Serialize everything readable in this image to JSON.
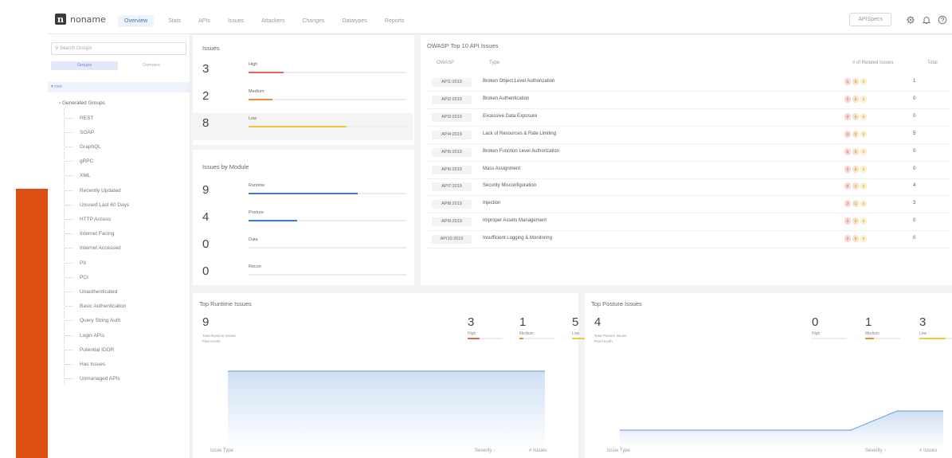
{
  "nav": {
    "logo_letter": "n",
    "logo_text": "noname",
    "items": [
      "Overview",
      "Stats",
      "APIs",
      "Issues",
      "Attackers",
      "Changes",
      "Datatypes",
      "Reports"
    ],
    "apispecs": "APISpecs"
  },
  "sidebar": {
    "search_placeholder": "Search Groups",
    "tabs": [
      "Groups",
      "Domains"
    ],
    "root": "▾ root",
    "generated": "› Generated Groups",
    "items": [
      "REST",
      "SOAP",
      "GraphQL",
      "gRPC",
      "XML",
      "Recently Updated",
      "Unused Last 60 Days",
      "HTTP Access",
      "Internet Facing",
      "Internet Accessed",
      "PII",
      "PCI",
      "Unauthenticated",
      "Basic Authentication",
      "Query String Auth",
      "Login APIs",
      "Potential IDOR",
      "Has Issues",
      "Unmanaged APIs"
    ]
  },
  "issues": {
    "title": "Issues",
    "rows": [
      {
        "num": "3",
        "label": "High",
        "frac": 0.22,
        "color": "#e0685a"
      },
      {
        "num": "2",
        "label": "Medium",
        "frac": 0.15,
        "color": "#ef8c2b"
      },
      {
        "num": "8",
        "label": "Low",
        "frac": 0.62,
        "color": "#f1c645"
      }
    ]
  },
  "modules": {
    "title": "Issues by Module",
    "rows": [
      {
        "num": "9",
        "label": "Runtime",
        "frac": 0.69,
        "color": "#3b7dcc"
      },
      {
        "num": "4",
        "label": "Posture",
        "frac": 0.31,
        "color": "#3b7dcc"
      },
      {
        "num": "0",
        "label": "Data",
        "frac": 0,
        "color": "#3b7dcc"
      },
      {
        "num": "0",
        "label": "Recon",
        "frac": 0,
        "color": "#3b7dcc"
      }
    ]
  },
  "owasp": {
    "title": "OWASP Top 10 API Issues",
    "headers": {
      "code": "OWASP",
      "type": "Type",
      "related": "# of Related Issues",
      "total": "Total"
    },
    "rows": [
      {
        "code": "API1:2019",
        "type": "Broken Object Level Authorization",
        "h": "1",
        "m": "0",
        "l": "0",
        "total": "1"
      },
      {
        "code": "API2:2019",
        "type": "Broken Authentication",
        "h": "0",
        "m": "0",
        "l": "0",
        "total": "0"
      },
      {
        "code": "API3:2019",
        "type": "Excessive Data Exposure",
        "h": "0",
        "m": "0",
        "l": "0",
        "total": "0"
      },
      {
        "code": "API4:2019",
        "type": "Lack of Resources & Rate Limiting",
        "h": "0",
        "m": "0",
        "l": "5",
        "total": "5"
      },
      {
        "code": "API5:2019",
        "type": "Broken Function Level Authorization",
        "h": "0",
        "m": "0",
        "l": "0",
        "total": "0"
      },
      {
        "code": "API6:2019",
        "type": "Mass Assignment",
        "h": "0",
        "m": "0",
        "l": "0",
        "total": "0"
      },
      {
        "code": "API7:2019",
        "type": "Security Misconfiguration",
        "h": "0",
        "m": "1",
        "l": "3",
        "total": "4"
      },
      {
        "code": "API8:2019",
        "type": "Injection",
        "h": "2",
        "m": "1",
        "l": "0",
        "total": "3"
      },
      {
        "code": "API9:2019",
        "type": "Improper Assets Management",
        "h": "0",
        "m": "0",
        "l": "0",
        "total": "0"
      },
      {
        "code": "API10:2019",
        "type": "Insufficient Logging & Monitoring",
        "h": "0",
        "m": "0",
        "l": "0",
        "total": "0"
      }
    ]
  },
  "runtime": {
    "title": "Top Runtime Issues",
    "total": "9",
    "total_label": "Total Runtime Issues",
    "period": "Past month",
    "sev": [
      {
        "n": "3",
        "l": "High",
        "color": "#e0685a",
        "frac": 0.35
      },
      {
        "n": "1",
        "l": "Medium",
        "color": "#ef8c2b",
        "frac": 0.12
      },
      {
        "n": "5",
        "l": "Low",
        "color": "#f1c645",
        "frac": 0.6
      }
    ],
    "series": [
      9,
      9,
      9,
      9,
      9,
      9,
      9
    ],
    "col_type": "Issue Type",
    "col_sev": "Severity ↑",
    "col_issues": "# Issues"
  },
  "posture": {
    "title": "Top Posture Issues",
    "total": "4",
    "total_label": "Total Posture Issues",
    "period": "Past month",
    "sev": [
      {
        "n": "0",
        "l": "High",
        "color": "#e0685a",
        "frac": 0
      },
      {
        "n": "1",
        "l": "Medium",
        "color": "#ef8c2b",
        "frac": 0.25
      },
      {
        "n": "3",
        "l": "Low",
        "color": "#f1c645",
        "frac": 0.75
      }
    ],
    "series": [
      2,
      2,
      2,
      2,
      2,
      2,
      4,
      4
    ],
    "col_type": "Issue Type",
    "col_sev": "Severity ↑",
    "col_issues": "# Issues"
  }
}
